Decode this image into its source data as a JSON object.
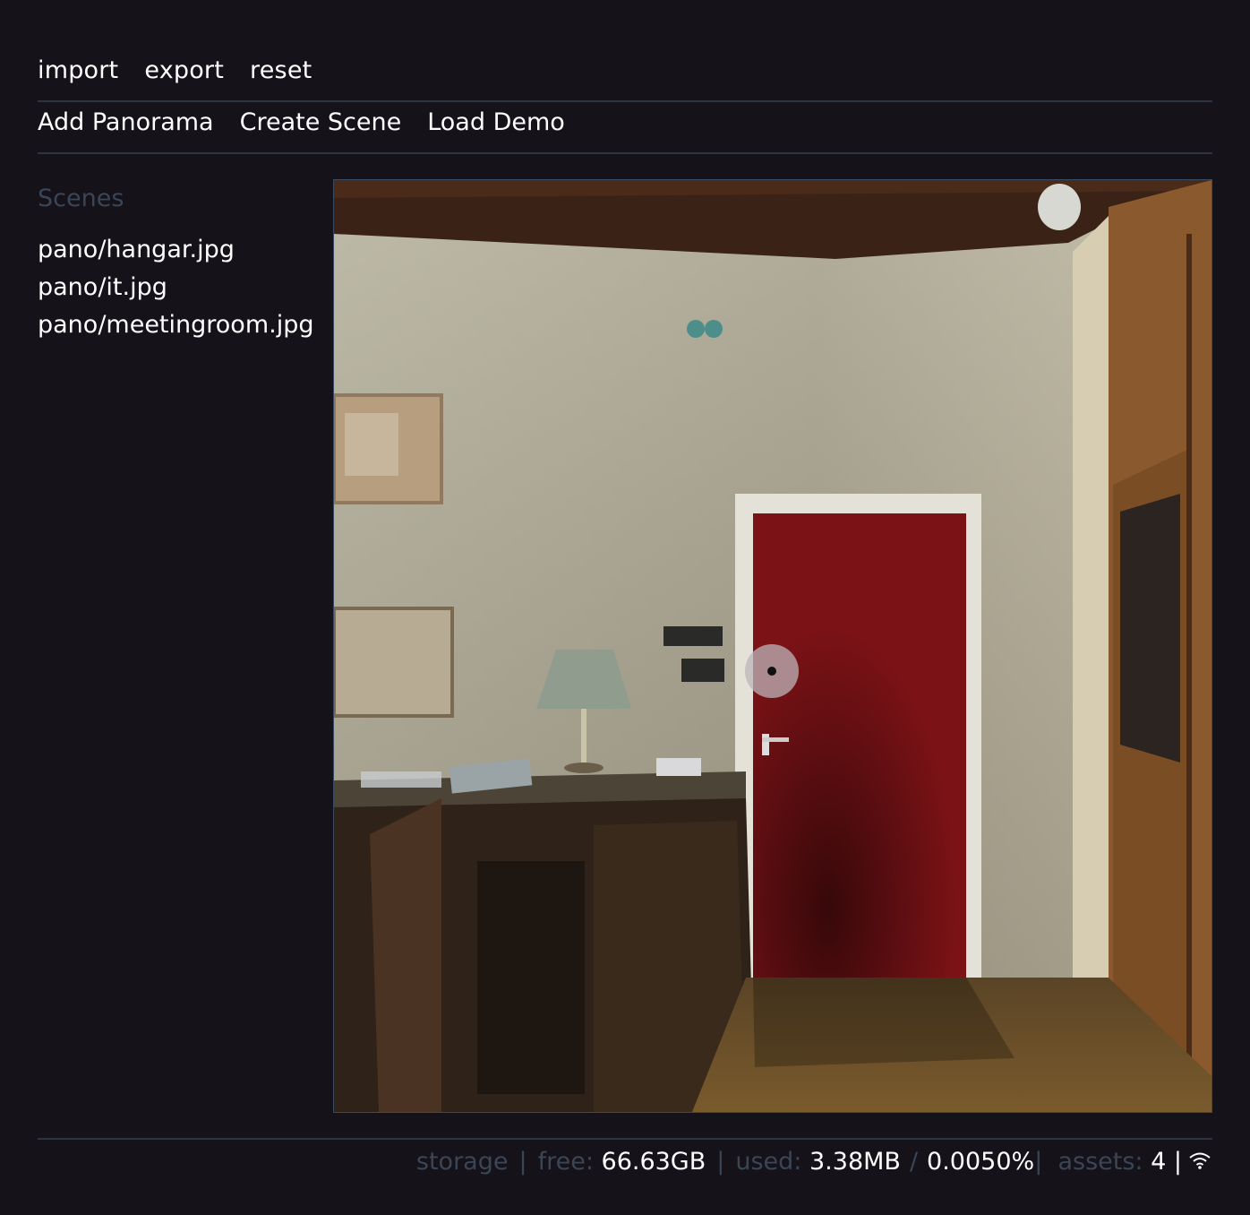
{
  "toolbar": {
    "import_label": "import",
    "export_label": "export",
    "reset_label": "reset"
  },
  "actions": {
    "add_panorama_label": "Add Panorama",
    "create_scene_label": "Create Scene",
    "load_demo_label": "Load Demo"
  },
  "sidebar": {
    "title": "Scenes",
    "items": [
      {
        "label": "pano/hangar.jpg"
      },
      {
        "label": "pano/it.jpg"
      },
      {
        "label": "pano/meetingroom.jpg"
      }
    ]
  },
  "status": {
    "storage_label": "storage",
    "sep": "|",
    "free_label": "free:",
    "free_value": "66.63GB",
    "used_label": "used:",
    "used_value": "3.38MB",
    "slash": "/",
    "used_percent": "0.0050%",
    "assets_label": "assets:",
    "assets_value": "4",
    "bar": "|",
    "connection_icon": "wifi-icon"
  },
  "colors": {
    "background": "#16121a",
    "rule": "#2e3440",
    "muted": "#3a4556",
    "door": "#7a1216"
  }
}
